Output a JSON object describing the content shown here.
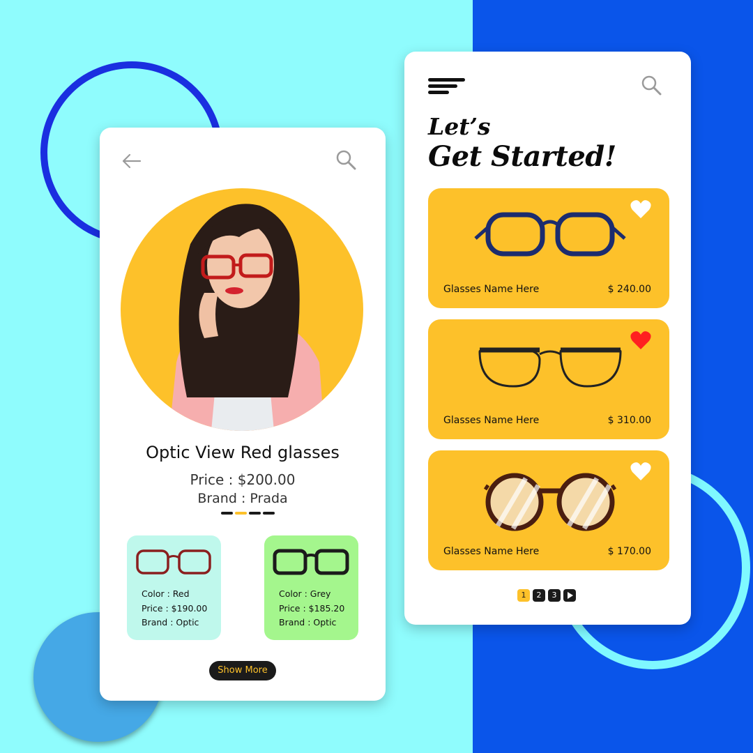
{
  "product_detail": {
    "name": "Optic View Red glasses",
    "price": "Price : $200.00",
    "brand": "Brand : Prada",
    "variants": [
      {
        "color": "Color : Red",
        "price": "Price : $190.00",
        "brand": "Brand : Optic",
        "frame_color": "#8a1f1f"
      },
      {
        "color": "Color : Grey",
        "price": "Price : $185.20",
        "brand": "Brand : Optic",
        "frame_color": "#1b1b1b"
      }
    ],
    "show_more_label": "Show More",
    "carousel": {
      "count": 4,
      "active": 1
    }
  },
  "catalog": {
    "heading_line1": "Let’s",
    "heading_line2": "Get Started!",
    "products": [
      {
        "name": "Glasses Name Here",
        "price": "$ 240.00",
        "favorite": false,
        "frame_color": "#1c2c6e"
      },
      {
        "name": "Glasses Name Here",
        "price": "$ 310.00",
        "favorite": true,
        "frame_color": "#222222"
      },
      {
        "name": "Glasses Name Here",
        "price": "$ 170.00",
        "favorite": false,
        "frame_color": "#4a1e10"
      }
    ],
    "pagination": [
      "1",
      "2",
      "3"
    ],
    "active_page": "1"
  },
  "colors": {
    "accent_yellow": "#fdc12a",
    "cyan_bg": "#8ffcfd",
    "blue_bg": "#0a55ea",
    "heart_active": "#ff2020"
  }
}
